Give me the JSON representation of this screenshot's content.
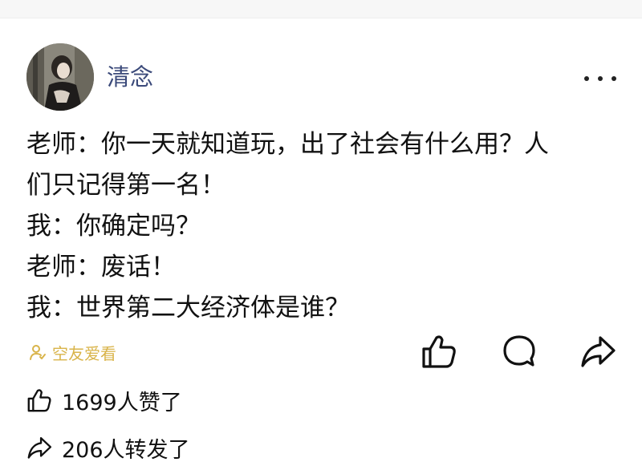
{
  "post": {
    "username": "清念",
    "lines": [
      "老师：你一天就知道玩，出了社会有什么用？人",
      "们只记得第一名！",
      "我：你确定吗？",
      "老师：废话！",
      "我：世界第二大经济体是谁？"
    ],
    "badge_label": "空友爱看",
    "icons": {
      "more": "more-icon",
      "like": "thumbs-up-icon",
      "comment": "comment-icon",
      "share": "share-icon",
      "badge": "friends-icon"
    }
  },
  "stats": {
    "likes_text": "1699人赞了",
    "reposts_text": "206人转发了"
  },
  "colors": {
    "username": "#3b4a7a",
    "badge": "#d9b44a",
    "text": "#111111"
  }
}
